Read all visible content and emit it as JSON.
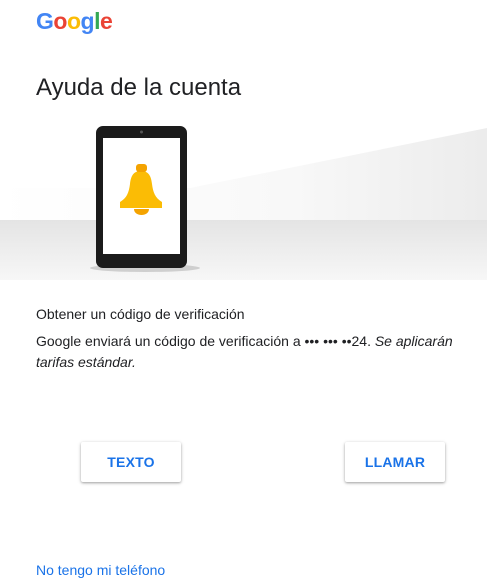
{
  "brand": {
    "logo_letters": [
      "G",
      "o",
      "o",
      "g",
      "l",
      "e"
    ],
    "logo_colors": [
      "#4285F4",
      "#EA4335",
      "#FBBC05",
      "#4285F4",
      "#34A853",
      "#EA4335"
    ]
  },
  "header": {
    "title": "Ayuda de la cuenta"
  },
  "illustration": {
    "device_icon": "phone-icon",
    "notification_icon": "bell-icon",
    "bell_color": "#FBBC05"
  },
  "content": {
    "subtitle": "Obtener un código de verificación",
    "description_main": "Google enviará un código de verificación a ••• ••• ••24. ",
    "description_note": "Se aplicarán tarifas estándar."
  },
  "actions": {
    "text_label": "TEXTO",
    "call_label": "LLAMAR",
    "no_phone_link": "No tengo mi teléfono"
  },
  "colors": {
    "accent": "#1a73e8",
    "text": "#202124"
  }
}
